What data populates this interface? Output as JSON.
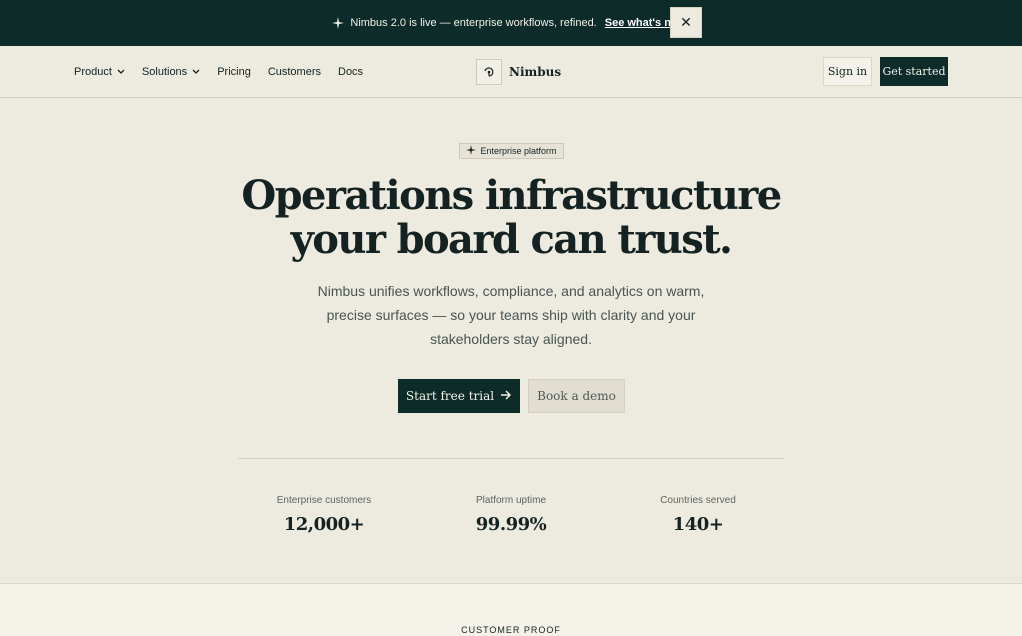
{
  "announcement": {
    "icon": "sparkle-icon",
    "text": "Nimbus 2.0 is live — enterprise workflows, refined.",
    "link": "See what's new",
    "close": "✕"
  },
  "nav": {
    "links": [
      {
        "label": "Product",
        "has_dropdown": true
      },
      {
        "label": "Solutions",
        "has_dropdown": true
      },
      {
        "label": "Pricing",
        "has_dropdown": false
      },
      {
        "label": "Customers",
        "has_dropdown": false
      },
      {
        "label": "Docs",
        "has_dropdown": false
      }
    ],
    "brand": "Nimbus",
    "sign_in": "Sign in",
    "get_started": "Get started"
  },
  "hero": {
    "badge": "Enterprise platform",
    "headline_line1": "Operations infrastructure",
    "headline_line2": "your board can trust.",
    "subtitle": "Nimbus unifies workflows, compliance, and analytics on warm, precise surfaces — so your teams ship with clarity and your stakeholders stay aligned.",
    "primary_cta": "Start free trial",
    "secondary_cta": "Book a demo"
  },
  "stats": [
    {
      "label": "Enterprise customers",
      "value": "12,000+"
    },
    {
      "label": "Platform uptime",
      "value": "99.99%"
    },
    {
      "label": "Countries served",
      "value": "140+"
    }
  ],
  "proof": {
    "eyebrow": "CUSTOMER PROOF"
  },
  "colors": {
    "brand_dark": "#0d2b29",
    "background": "#edeadf",
    "surface": "#f5f2ea",
    "text": "#142322"
  }
}
